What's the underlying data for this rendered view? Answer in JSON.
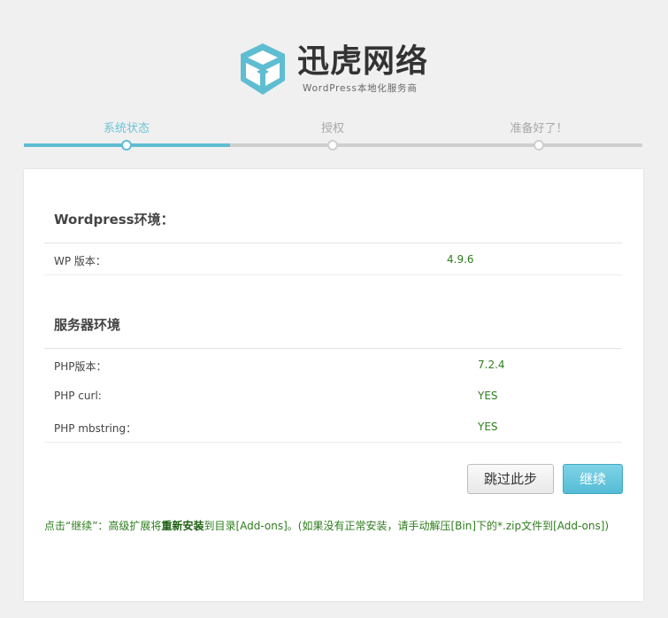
{
  "brand": {
    "name": "迅虎网络",
    "tagline": "WordPress本地化服务商",
    "colors": {
      "primary": "#55bcd6",
      "value_text": "#2e7d1e"
    }
  },
  "steps": [
    {
      "label": "系统状态",
      "active": true
    },
    {
      "label": "授权",
      "active": false
    },
    {
      "label": "准备好了！",
      "active": false
    }
  ],
  "wordpress_env": {
    "title": "Wordpress环境：",
    "rows": [
      {
        "label": "WP 版本：",
        "value": "4.9.6"
      }
    ]
  },
  "server_env": {
    "title": "服务器环境",
    "rows": [
      {
        "label": "PHP版本：",
        "value": "7.2.4"
      },
      {
        "label": "PHP curl:",
        "value": "YES"
      },
      {
        "label": "PHP mbstring：",
        "value": "YES"
      }
    ]
  },
  "buttons": {
    "skip": "跳过此步",
    "continue": "继续"
  },
  "note": {
    "part1": "点击“继续”：高级扩展将",
    "bold": "重新安装",
    "part2": "到目录[Add-ons]。(如果没有正常安装，请手动解压[Bin]下的*.zip文件到[Add-ons])"
  }
}
